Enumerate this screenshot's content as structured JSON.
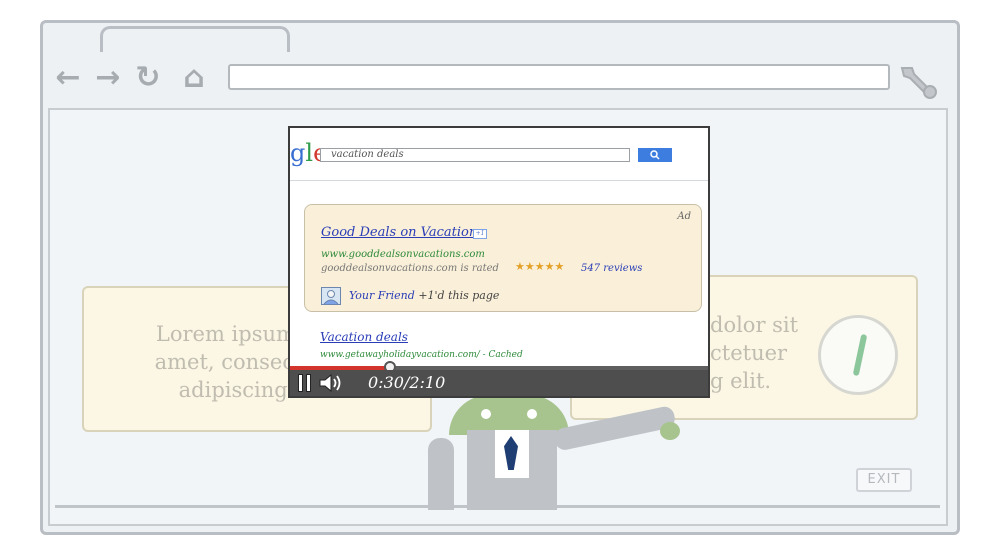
{
  "background_card_left": {
    "lines": [
      "Lorem ipsum dolor",
      "amet, consectetuer",
      "adipiscing elit."
    ]
  },
  "background_card_right": {
    "lines": [
      "dolor sit",
      "ctetuer",
      "g elit."
    ]
  },
  "exit_label": "EXIT",
  "video": {
    "search_query": "vacation deals",
    "ad": {
      "badge": "Ad",
      "title": "Good Deals on Vacations",
      "plus_one": "+1",
      "url": "www.gooddealsonvacations.com",
      "rated_text": "gooddealsonvacations.com is rated",
      "stars": "★★★★★",
      "reviews": "547 reviews",
      "friend_name": "Your Friend",
      "friend_action": "+1'd this page"
    },
    "result": {
      "title": "Vacation deals",
      "url": "www.getawayholidayvacation.com/ - Cached"
    },
    "player": {
      "current_time": "0:30",
      "total_time": "2:10",
      "progress_fraction": 0.24
    }
  },
  "colors": {
    "progress": "#d3342b",
    "link": "#2a3db7",
    "url_green": "#2e8a3a",
    "card_bg": "#fbf7e4"
  },
  "icons": [
    "back-arrow-icon",
    "forward-arrow-icon",
    "reload-icon",
    "home-icon",
    "wrench-icon",
    "pause-icon",
    "volume-icon",
    "star-icon",
    "avatar-icon",
    "android-mascot"
  ]
}
